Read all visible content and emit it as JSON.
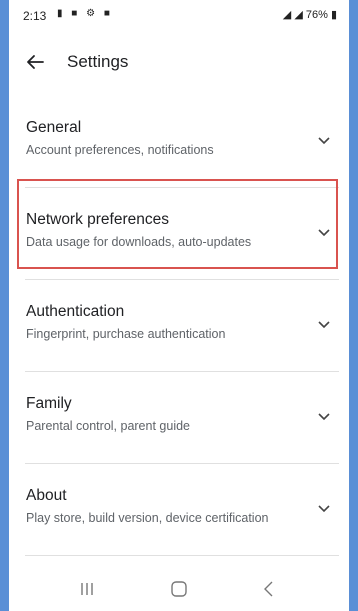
{
  "status_bar": {
    "time": "2:13",
    "battery": "76%"
  },
  "header": {
    "title": "Settings"
  },
  "settings": {
    "items": [
      {
        "label": "General",
        "description": "Account preferences, notifications"
      },
      {
        "label": "Network preferences",
        "description": "Data usage for downloads, auto-updates"
      },
      {
        "label": "Authentication",
        "description": "Fingerprint, purchase authentication"
      },
      {
        "label": "Family",
        "description": "Parental control, parent guide"
      },
      {
        "label": "About",
        "description": "Play store, build version, device certification"
      }
    ]
  },
  "colors": {
    "highlight": "#d9534f",
    "frame": "#5a8fd6"
  }
}
